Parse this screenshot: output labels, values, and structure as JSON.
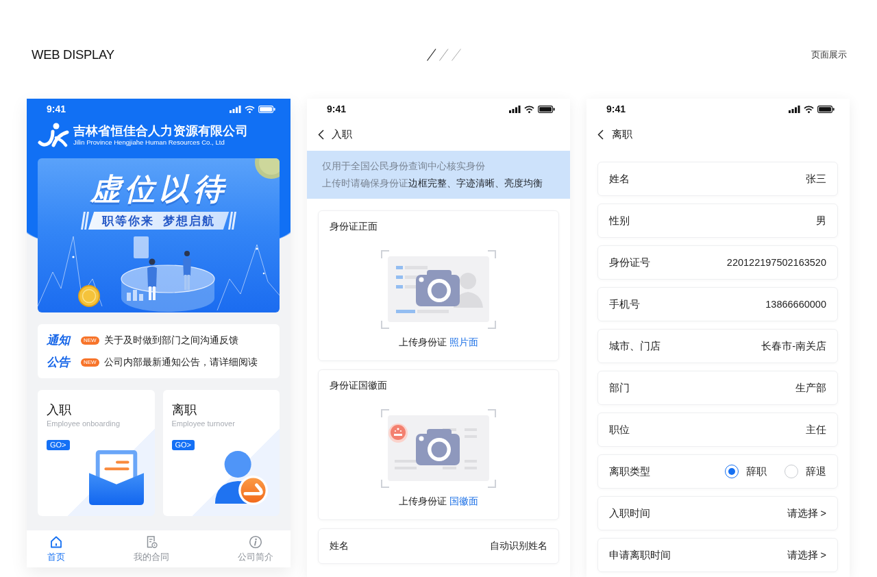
{
  "header": {
    "title": "WEB DISPLAY",
    "subtitle": "页面展示"
  },
  "home_screen": {
    "status_bar": {
      "time": "9:41"
    },
    "company": {
      "name": "吉林省恒佳合人力资源有限公司",
      "name_en": "Jilin Province Hengjiahe Human Resources Co., Ltd"
    },
    "banner": {
      "title": "虚位以待",
      "slogan": "职等你来  梦想启航"
    },
    "notices": [
      {
        "label": "通知",
        "badge": "NEW",
        "text": "关于及时做到部门之间沟通反馈"
      },
      {
        "label": "公告",
        "badge": "NEW",
        "text": "公司内部最新通知公告，请详细阅读"
      }
    ],
    "entry_cards": [
      {
        "title": "入职",
        "subtitle": "Employee onboarding",
        "button": "GO>"
      },
      {
        "title": "离职",
        "subtitle": "Employee turnover",
        "button": "GO>"
      }
    ],
    "tab_bar": [
      {
        "label": "首页",
        "selected": true
      },
      {
        "label": "我的合同",
        "selected": false
      },
      {
        "label": "公司简介",
        "selected": false
      }
    ]
  },
  "onboarding_screen": {
    "status_bar": {
      "time": "9:41"
    },
    "nav": {
      "title": "入职"
    },
    "hint_lines": [
      {
        "segments": [
          {
            "text": "仅用于全国公民身份查询中心核实身份",
            "highlight": false
          }
        ]
      },
      {
        "segments": [
          {
            "text": "上传时请确保身份证",
            "highlight": false
          },
          {
            "text": "边框完整、字迹清晰、亮度均衡",
            "highlight": true
          }
        ]
      }
    ],
    "upload_cards": [
      {
        "title": "身份证正面",
        "caption": "上传身份证",
        "link": "照片面"
      },
      {
        "title": "身份证国徽面",
        "caption": "上传身份证",
        "link": "国徽面"
      }
    ],
    "fields": [
      {
        "label": "姓名",
        "value": "自动识别姓名"
      }
    ]
  },
  "resignation_screen": {
    "status_bar": {
      "time": "9:41"
    },
    "nav": {
      "title": "离职"
    },
    "fields": [
      {
        "kind": "text",
        "label": "姓名",
        "value": "张三"
      },
      {
        "kind": "text",
        "label": "性别",
        "value": "男"
      },
      {
        "kind": "text",
        "label": "身份证号",
        "value": "220122197502163520"
      },
      {
        "kind": "text",
        "label": "手机号",
        "value": "13866660000"
      },
      {
        "kind": "text",
        "label": "城市、门店",
        "value": "长春市-南关店"
      },
      {
        "kind": "text",
        "label": "部门",
        "value": "生产部"
      },
      {
        "kind": "text",
        "label": "职位",
        "value": "主任"
      },
      {
        "kind": "radio",
        "label": "离职类型",
        "options": [
          {
            "label": "辞职",
            "selected": true
          },
          {
            "label": "辞退",
            "selected": false
          }
        ]
      },
      {
        "kind": "select",
        "label": "入职时间",
        "value": "请选择 >"
      },
      {
        "kind": "select",
        "label": "申请离职时间",
        "value": "请选择 >"
      }
    ]
  }
}
